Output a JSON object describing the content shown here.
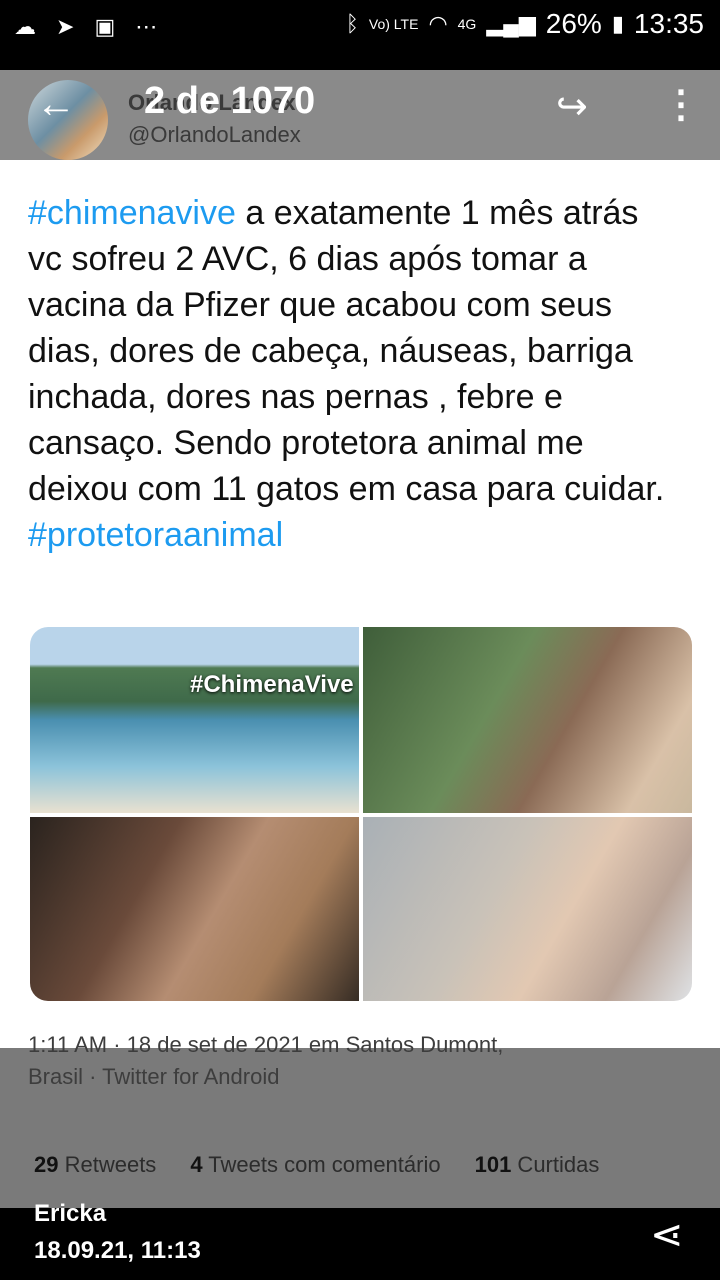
{
  "status_bar": {
    "battery": "26%",
    "time": "13:35",
    "network": "4G",
    "volte": "Vo) LTE",
    "left_icons": [
      "cloud-icon",
      "telegram-icon",
      "image-icon",
      "more-dots-icon"
    ],
    "right_icons": [
      "bluetooth-icon",
      "volte-icon",
      "wifi-icon",
      "signal-icon",
      "battery-icon"
    ]
  },
  "viewer": {
    "page_count": "2 de 1070"
  },
  "tweet": {
    "author": "Orlando Landex",
    "handle": "@OrlandoLandex",
    "hashtag1": "#chimenavive",
    "body": " a exatamente 1 mês atrás vc sofreu 2 AVC, 6 dias após tomar a vacina da Pfizer que acabou com seus dias, dores de cabeça, náuseas, barriga inchada, dores nas pernas , febre e cansaço. Sendo protetora animal me deixou com 11 gatos em casa para cuidar.",
    "hashtag2": "#protetoraanimal",
    "photo_caption": "#ChimenaVive",
    "meta_line1": "1:11 AM · 18 de set de 2021 em Santos Dumont,",
    "meta_line2": "Brasil · Twitter for Android",
    "stats": {
      "retweets_num": "29",
      "retweets_label": " Retweets",
      "comments_num": "4",
      "comments_label": " Tweets com comentário",
      "likes_num": "101",
      "likes_label": " Curtidas"
    }
  },
  "footer": {
    "sender": "Ericka",
    "sent_time": "18.09.21, 11:13"
  },
  "colors": {
    "hashtag": "#1d9bf0",
    "viewer_bar": "#8a8a8a",
    "background": "#000000"
  }
}
